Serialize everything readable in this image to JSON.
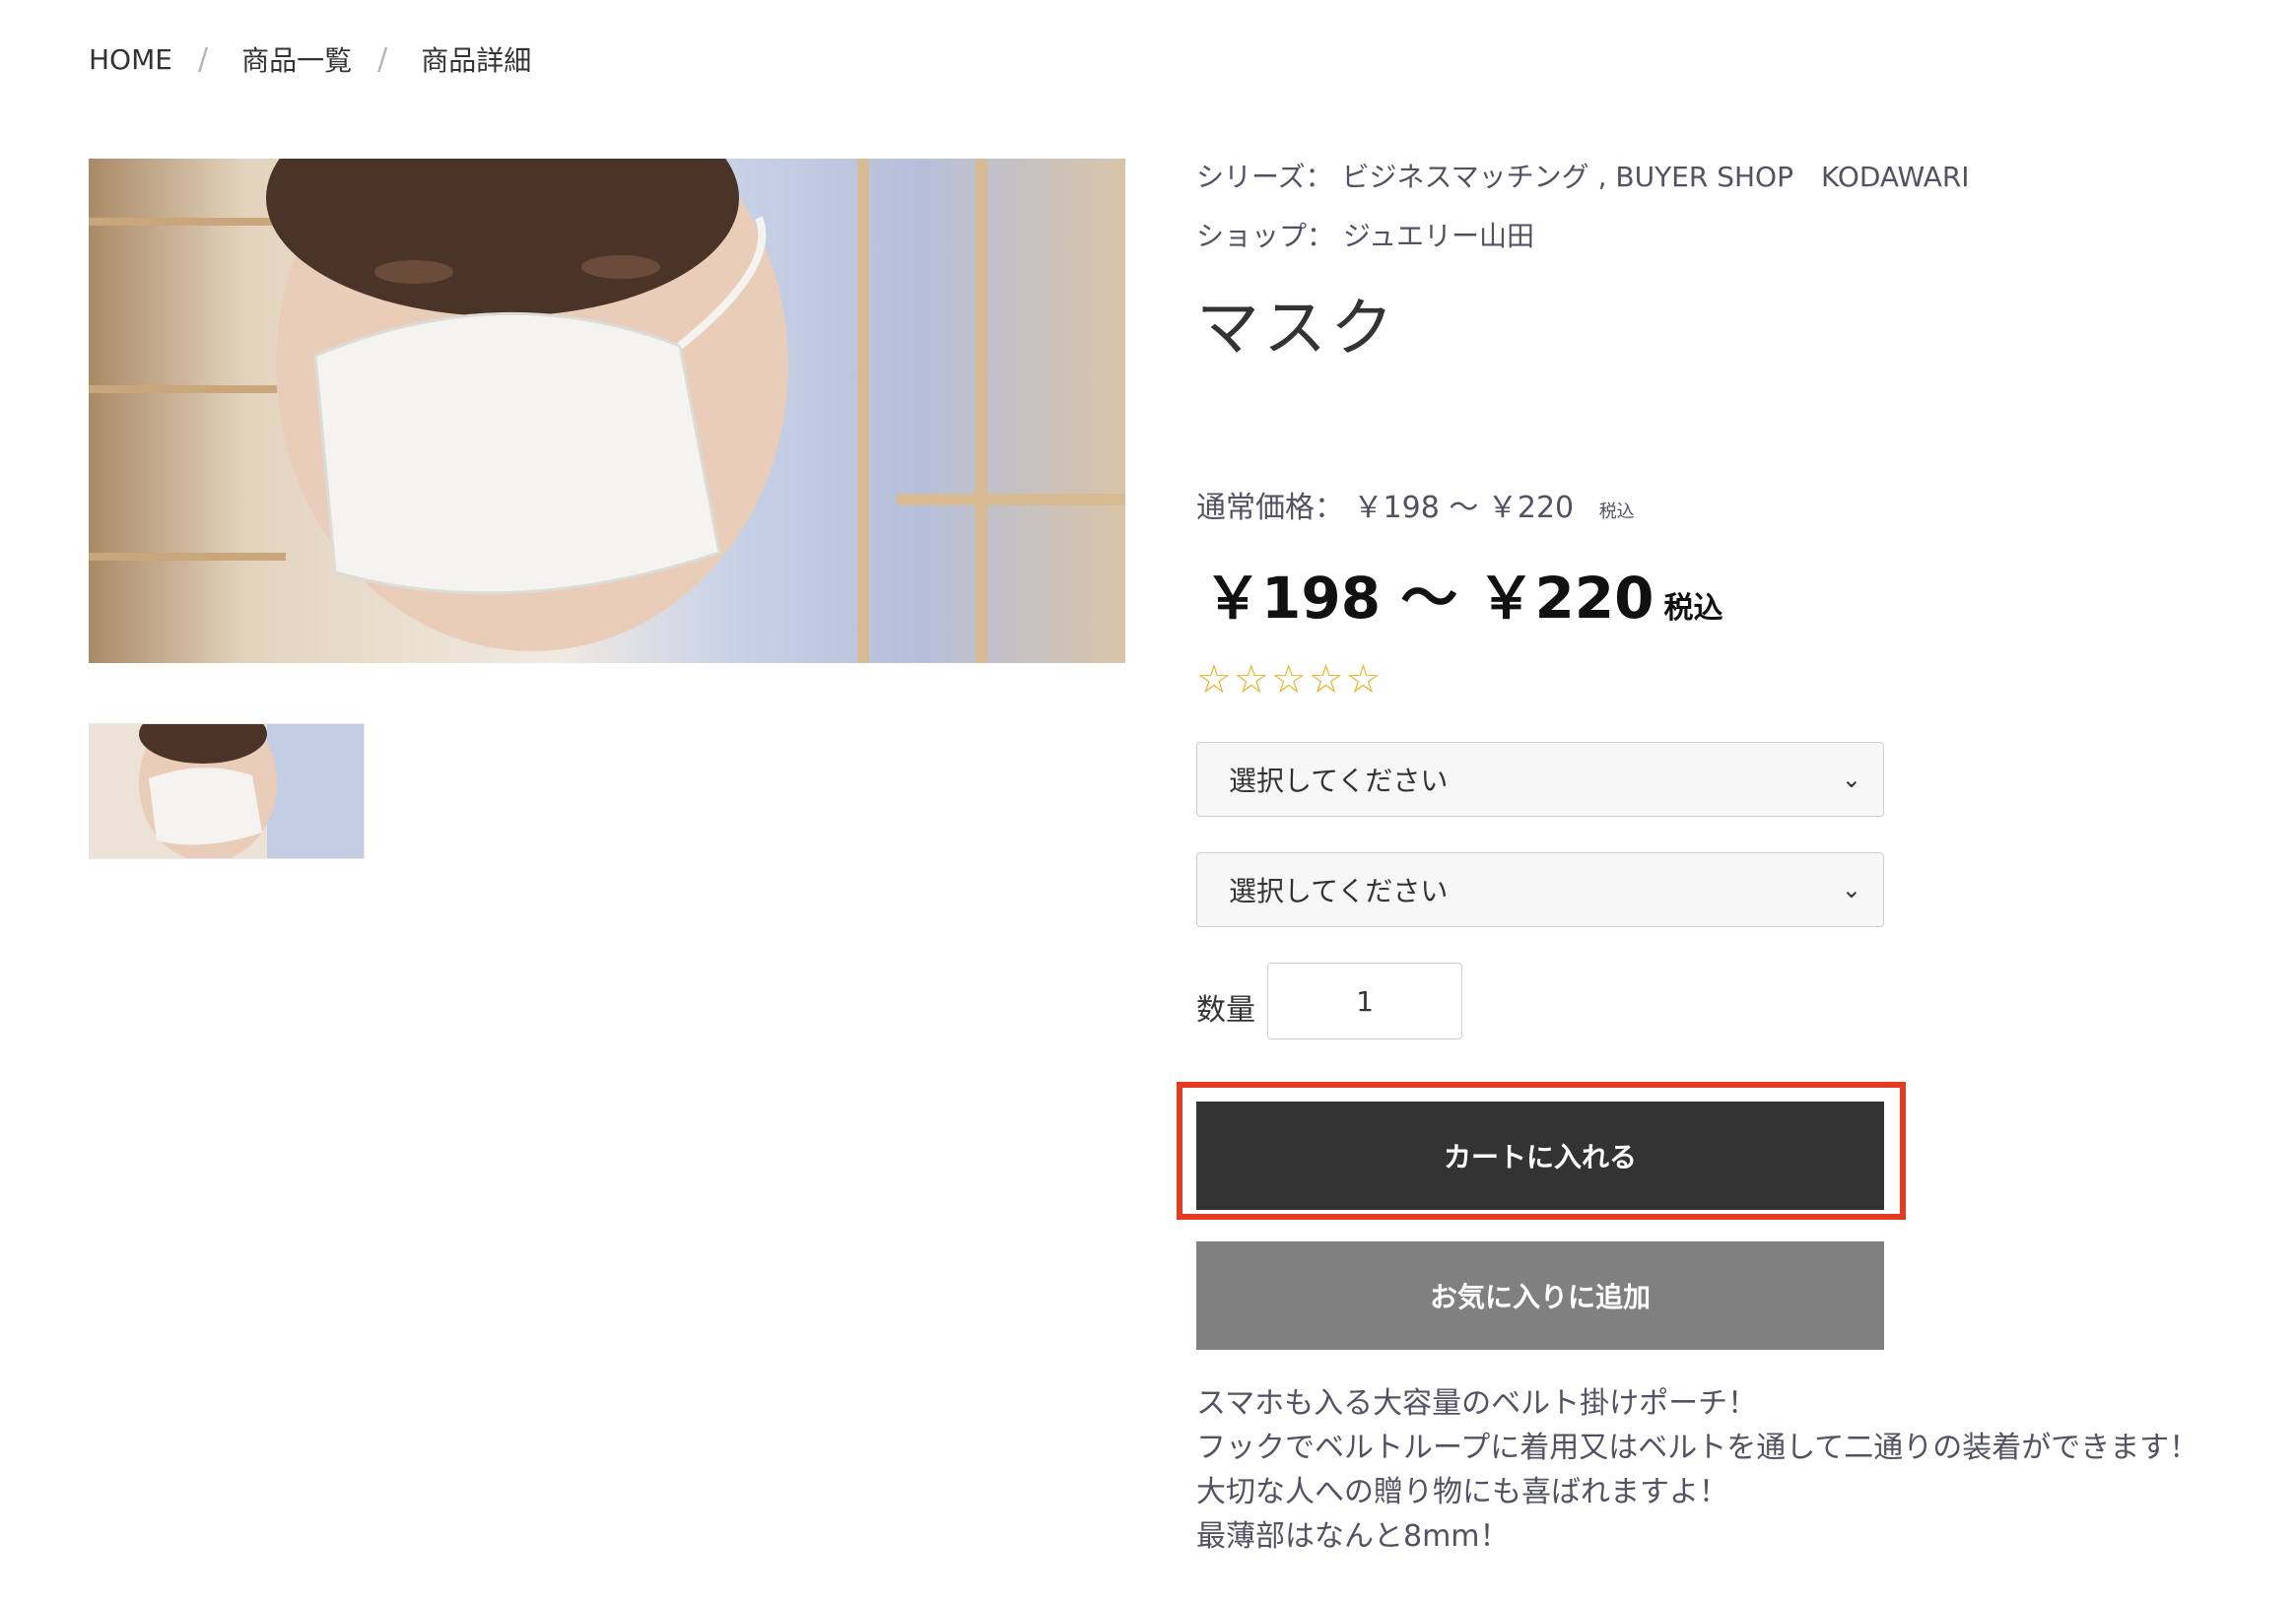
{
  "breadcrumb": {
    "items": [
      "HOME",
      "商品一覧",
      "商品詳細"
    ],
    "separator": "/"
  },
  "product": {
    "series_label": "シリーズ：",
    "series_value": "ビジネスマッチング , BUYER SHOP　KODAWARI",
    "shop_label": "ショップ：",
    "shop_value": "ジュエリー山田",
    "title": "マスク",
    "normal_price_label": "通常価格：",
    "normal_price_value": "￥198 ～ ￥220",
    "normal_price_tax": "税込",
    "sale_price": "￥198 ～ ￥220",
    "sale_price_tax": "税込",
    "rating": {
      "stars": 5,
      "filled": 0,
      "glyph": "☆"
    },
    "options": [
      {
        "value": "選択してください"
      },
      {
        "value": "選択してください"
      }
    ],
    "quantity_label": "数量",
    "quantity_value": "1",
    "cart_button": "カートに入れる",
    "favorite_button": "お気に入りに追加",
    "description": [
      "スマホも入る大容量のベルト掛けポーチ！",
      "フックでベルトループに着用又はベルトを通して二通りの装着ができます！",
      "大切な人への贈り物にも喜ばれますよ！",
      "最薄部はなんと8mm！"
    ]
  },
  "colors": {
    "cart_bg": "#333333",
    "favorite_bg": "#808080",
    "highlight": "#e53a22",
    "star": "#f2b01e"
  }
}
